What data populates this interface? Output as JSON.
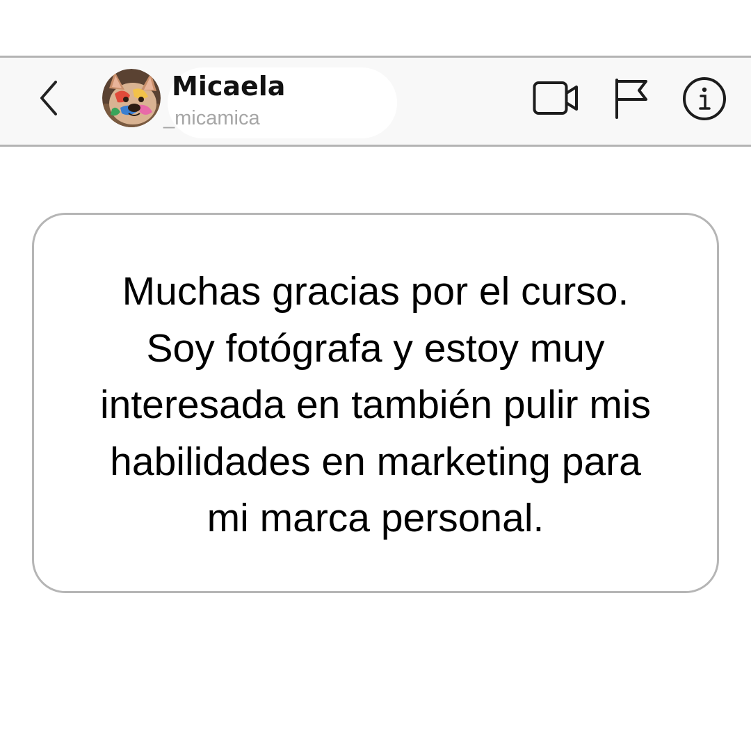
{
  "header": {
    "back_icon": "chevron-left-icon",
    "avatar_icon": "french-bulldog-avatar",
    "display_name": "Micaela",
    "username": "_micamica",
    "actions": [
      {
        "icon": "video-camera-icon"
      },
      {
        "icon": "flag-icon"
      },
      {
        "icon": "info-icon"
      }
    ]
  },
  "message": {
    "lines": [
      "Muchas gracias por el curso.",
      "Soy fotógrafa y estoy muy",
      "interesada en también pulir mis",
      "habilidades en marketing para",
      "mi marca personal."
    ]
  },
  "colors": {
    "background": "#ffffff",
    "header_background": "#f8f8f8",
    "border": "#b4b4b4",
    "text": "#000000",
    "username": "#a6a6a6"
  }
}
